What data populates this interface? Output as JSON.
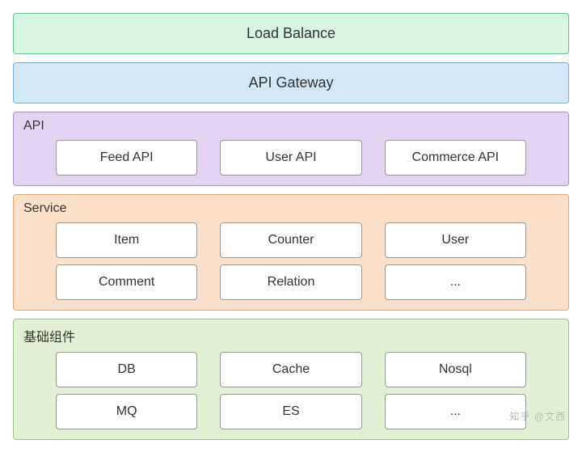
{
  "layers": {
    "load_balance": {
      "label": "Load Balance"
    },
    "api_gateway": {
      "label": "API Gateway"
    },
    "api": {
      "title": "API",
      "rows": [
        {
          "items": [
            "Feed API",
            "User API",
            "Commerce API"
          ]
        }
      ]
    },
    "service": {
      "title": "Service",
      "rows": [
        {
          "items": [
            "Item",
            "Counter",
            "User"
          ]
        },
        {
          "items": [
            "Comment",
            "Relation",
            "..."
          ]
        }
      ]
    },
    "infra": {
      "title": "基础组件",
      "rows": [
        {
          "items": [
            "DB",
            "Cache",
            "Nosql"
          ]
        },
        {
          "items": [
            "MQ",
            "ES",
            "..."
          ]
        }
      ]
    }
  },
  "watermark": "知乎 @文西"
}
